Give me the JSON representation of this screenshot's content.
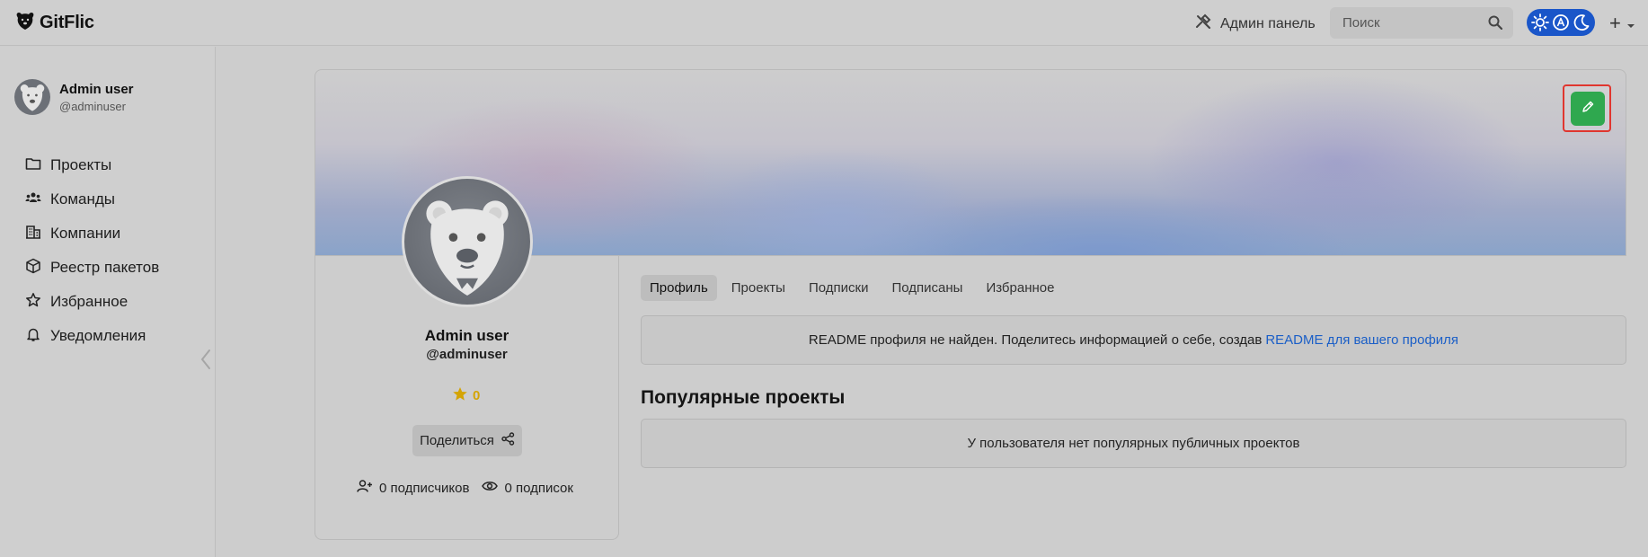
{
  "header": {
    "logo_text": "GitFlic",
    "admin_panel_label": "Админ панель",
    "search": {
      "placeholder": "Поиск",
      "value": ""
    },
    "plus_label": "+",
    "accent_color": "#1a56c9"
  },
  "sidebar": {
    "user": {
      "name": "Admin user",
      "handle": "@adminuser"
    },
    "items": [
      {
        "label": "Проекты",
        "icon": "folder-icon"
      },
      {
        "label": "Команды",
        "icon": "team-icon"
      },
      {
        "label": "Компании",
        "icon": "building-icon"
      },
      {
        "label": "Реестр пакетов",
        "icon": "package-icon"
      },
      {
        "label": "Избранное",
        "icon": "star-icon"
      },
      {
        "label": "Уведомления",
        "icon": "bell-icon"
      }
    ]
  },
  "profile": {
    "name": "Admin user",
    "handle": "@adminuser",
    "rating": "0",
    "share_label": "Поделиться",
    "followers_label": "0 подписчиков",
    "subscriptions_label": "0 подписок",
    "edit_button_color": "#2fa84f"
  },
  "tabs": [
    {
      "label": "Профиль",
      "active": true
    },
    {
      "label": "Проекты",
      "active": false
    },
    {
      "label": "Подписки",
      "active": false
    },
    {
      "label": "Подписаны",
      "active": false
    },
    {
      "label": "Избранное",
      "active": false
    }
  ],
  "readme": {
    "message": "README профиля не найден. Поделитесь информацией о себе, создав",
    "link_text": "README для вашего профиля"
  },
  "popular": {
    "title": "Популярные проекты",
    "empty_message": "У пользователя нет популярных публичных проектов"
  }
}
